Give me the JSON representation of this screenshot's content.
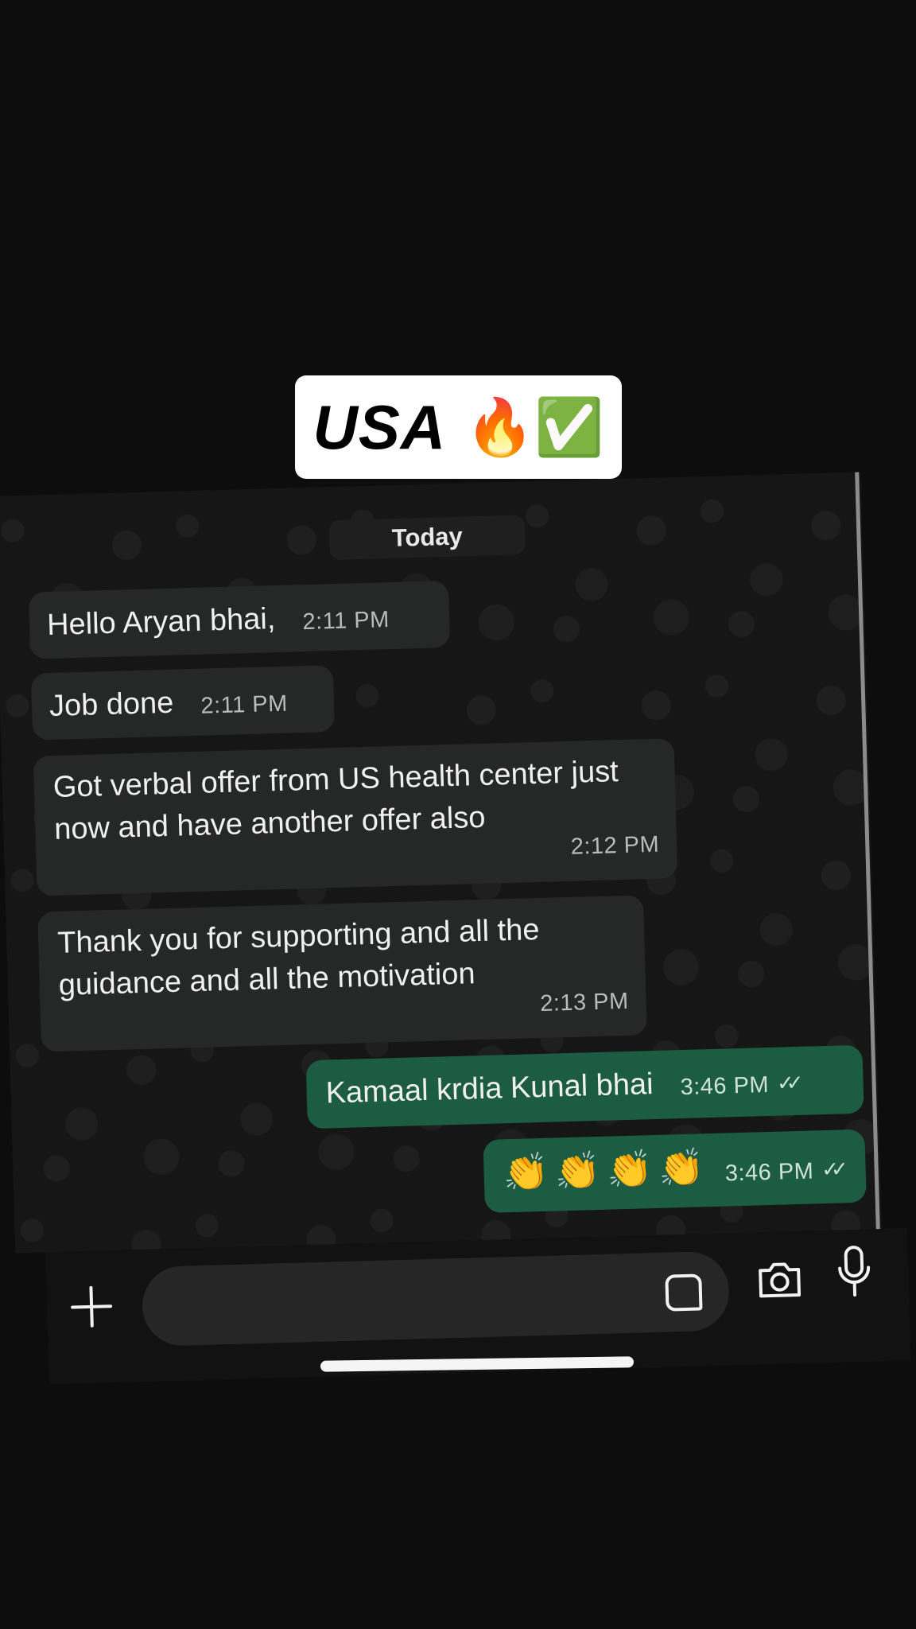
{
  "title_card": {
    "text": "USA",
    "emoji": "🔥✅"
  },
  "chat": {
    "date_label": "Today",
    "messages": [
      {
        "direction": "incoming",
        "text": "Hello Aryan bhai,",
        "time": "2:11 PM"
      },
      {
        "direction": "incoming",
        "text": "Job done",
        "time": "2:11 PM"
      },
      {
        "direction": "incoming",
        "text": "Got verbal offer from US health center just now and have another offer also",
        "time": "2:12 PM"
      },
      {
        "direction": "incoming",
        "text": "Thank you for supporting and all the guidance and all the motivation",
        "time": "2:13 PM"
      },
      {
        "direction": "outgoing",
        "text": "Kamaal krdia Kunal bhai",
        "time": "3:46 PM",
        "status": "read"
      },
      {
        "direction": "outgoing",
        "text": "👏👏👏👏",
        "time": "3:46 PM",
        "status": "read"
      }
    ],
    "read_tick": "✓✓",
    "colors": {
      "incoming_bubble": "#262727",
      "outgoing_bubble": "#1b5c42",
      "background": "#161616"
    }
  },
  "input_bar": {
    "icons": [
      "plus-icon",
      "sticker-icon",
      "camera-icon",
      "microphone-icon"
    ]
  }
}
